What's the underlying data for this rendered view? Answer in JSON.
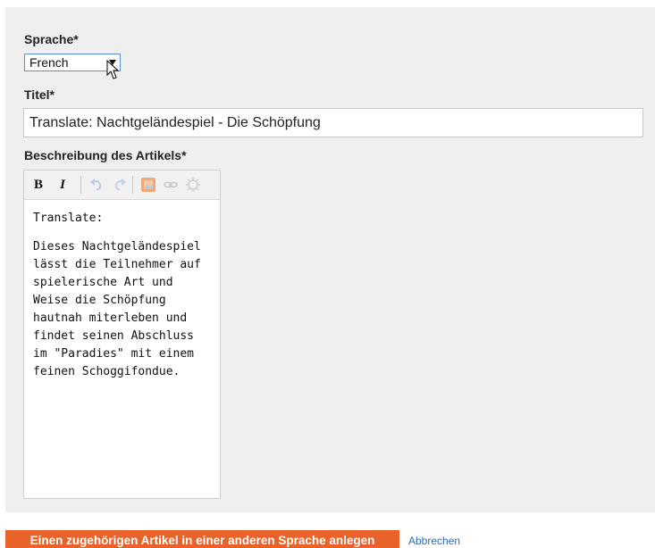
{
  "form": {
    "language_label": "Sprache*",
    "language_value": "French",
    "title_label": "Titel*",
    "title_value": "Translate: Nachtgeländespiel - Die Schöpfung",
    "description_label": "Beschreibung des Artikels*"
  },
  "toolbar": {
    "bold": "B",
    "italic": "I",
    "icons": [
      "undo-icon",
      "redo-icon",
      "insert-image-icon",
      "link-icon",
      "unlink-icon"
    ]
  },
  "editor": {
    "paragraph_1": "Translate:",
    "paragraph_2": "Dieses Nachtgeländespiel lässt die Teilnehmer auf spielerische Art und Weise die Schöpfung hautnah miterleben und findet seinen Abschluss im \"Paradies\" mit einem feinen Schoggifondue."
  },
  "actions": {
    "submit_label": "Einen zugehörigen Artikel in einer anderen Sprache anlegen",
    "cancel_label": "Abbrechen"
  },
  "colors": {
    "accent": "#e8622a",
    "link": "#2a6db5",
    "panel_background": "#efefef"
  }
}
